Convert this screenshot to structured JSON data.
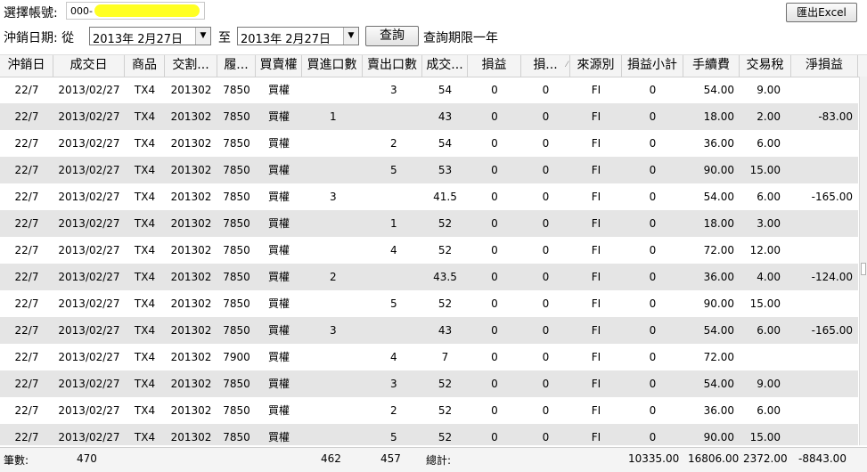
{
  "account": {
    "label": "選擇帳號:",
    "prefix": "000-"
  },
  "export_label": "匯出Excel",
  "date_range": {
    "label": "沖銷日期: 從",
    "from": "2013年  2月27日",
    "to_label": "至",
    "to": "2013年  2月27日",
    "query_label": "查詢",
    "limit_note": "查詢期限一年"
  },
  "columns": [
    "沖銷日",
    "成交日",
    "商品",
    "交割...",
    "履...",
    "買賣權",
    "買進口數",
    "賣出口數",
    "成交...",
    "損益",
    "損...",
    "來源別",
    "損益小計",
    "手續費",
    "交易稅",
    "淨損益"
  ],
  "rows": [
    [
      "22/7",
      "2013/02/27",
      "TX4",
      "201302",
      "7850",
      "買權",
      "",
      "3",
      "54",
      "0",
      "0",
      "FI",
      "0",
      "54.00",
      "9.00",
      ""
    ],
    [
      "22/7",
      "2013/02/27",
      "TX4",
      "201302",
      "7850",
      "買權",
      "1",
      "",
      "43",
      "0",
      "0",
      "FI",
      "0",
      "18.00",
      "2.00",
      "-83.00"
    ],
    [
      "22/7",
      "2013/02/27",
      "TX4",
      "201302",
      "7850",
      "買權",
      "",
      "2",
      "54",
      "0",
      "0",
      "FI",
      "0",
      "36.00",
      "6.00",
      ""
    ],
    [
      "22/7",
      "2013/02/27",
      "TX4",
      "201302",
      "7850",
      "買權",
      "",
      "5",
      "53",
      "0",
      "0",
      "FI",
      "0",
      "90.00",
      "15.00",
      ""
    ],
    [
      "22/7",
      "2013/02/27",
      "TX4",
      "201302",
      "7850",
      "買權",
      "3",
      "",
      "41.5",
      "0",
      "0",
      "FI",
      "0",
      "54.00",
      "6.00",
      "-165.00"
    ],
    [
      "22/7",
      "2013/02/27",
      "TX4",
      "201302",
      "7850",
      "買權",
      "",
      "1",
      "52",
      "0",
      "0",
      "FI",
      "0",
      "18.00",
      "3.00",
      ""
    ],
    [
      "22/7",
      "2013/02/27",
      "TX4",
      "201302",
      "7850",
      "買權",
      "",
      "4",
      "52",
      "0",
      "0",
      "FI",
      "0",
      "72.00",
      "12.00",
      ""
    ],
    [
      "22/7",
      "2013/02/27",
      "TX4",
      "201302",
      "7850",
      "買權",
      "2",
      "",
      "43.5",
      "0",
      "0",
      "FI",
      "0",
      "36.00",
      "4.00",
      "-124.00"
    ],
    [
      "22/7",
      "2013/02/27",
      "TX4",
      "201302",
      "7850",
      "買權",
      "",
      "5",
      "52",
      "0",
      "0",
      "FI",
      "0",
      "90.00",
      "15.00",
      ""
    ],
    [
      "22/7",
      "2013/02/27",
      "TX4",
      "201302",
      "7850",
      "買權",
      "3",
      "",
      "43",
      "0",
      "0",
      "FI",
      "0",
      "54.00",
      "6.00",
      "-165.00"
    ],
    [
      "22/7",
      "2013/02/27",
      "TX4",
      "201302",
      "7900",
      "買權",
      "",
      "4",
      "7",
      "0",
      "0",
      "FI",
      "0",
      "72.00",
      "",
      ""
    ],
    [
      "22/7",
      "2013/02/27",
      "TX4",
      "201302",
      "7850",
      "買權",
      "",
      "3",
      "52",
      "0",
      "0",
      "FI",
      "0",
      "54.00",
      "9.00",
      ""
    ],
    [
      "22/7",
      "2013/02/27",
      "TX4",
      "201302",
      "7850",
      "買權",
      "",
      "2",
      "52",
      "0",
      "0",
      "FI",
      "0",
      "36.00",
      "6.00",
      ""
    ],
    [
      "22/7",
      "2013/02/27",
      "TX4",
      "201302",
      "7850",
      "買權",
      "",
      "5",
      "52",
      "0",
      "0",
      "FI",
      "0",
      "90.00",
      "15.00",
      ""
    ]
  ],
  "footer": {
    "count_label": "筆數:",
    "count": "470",
    "buy_total": "462",
    "sell_total": "457",
    "total_label": "總計:",
    "subtotal_fee_sum": "10335.00",
    "fee_total": "16806.00",
    "tax_total": "2372.00",
    "net_total": "-8843.00"
  }
}
